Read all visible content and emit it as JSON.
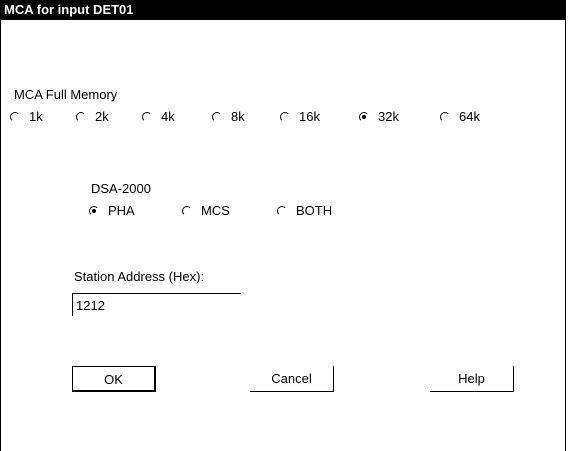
{
  "window": {
    "title": "MCA for input DET01"
  },
  "memory": {
    "label": "MCA Full Memory",
    "options": [
      {
        "label": "1k",
        "selected": false
      },
      {
        "label": "2k",
        "selected": false
      },
      {
        "label": "4k",
        "selected": false
      },
      {
        "label": "8k",
        "selected": false
      },
      {
        "label": "16k",
        "selected": false
      },
      {
        "label": "32k",
        "selected": true
      },
      {
        "label": "64k",
        "selected": false
      }
    ]
  },
  "dsa": {
    "label": "DSA-2000",
    "options": [
      {
        "label": "PHA",
        "selected": true
      },
      {
        "label": "MCS",
        "selected": false
      },
      {
        "label": "BOTH",
        "selected": false
      }
    ]
  },
  "station": {
    "label": "Station Address (Hex):",
    "value": "1212"
  },
  "buttons": {
    "ok": "OK",
    "cancel": "Cancel",
    "help": "Help"
  }
}
